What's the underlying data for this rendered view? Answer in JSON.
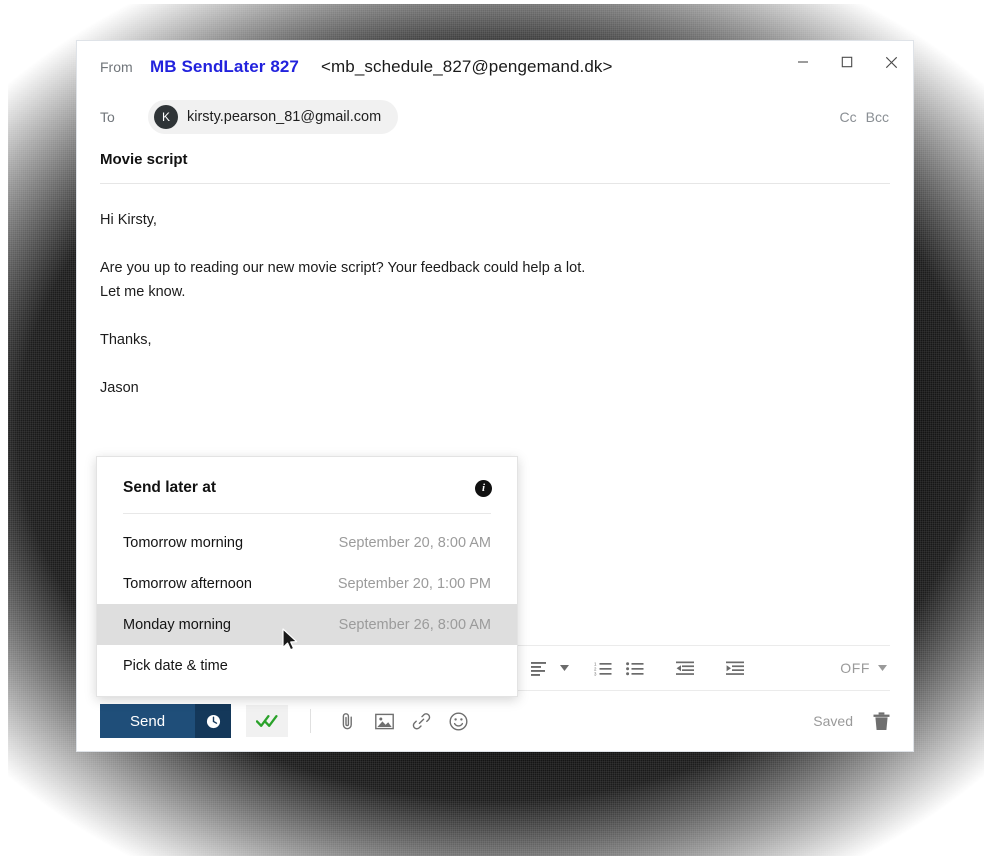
{
  "window": {
    "controls": {
      "minimize": "minimize-icon",
      "maximize": "maximize-icon",
      "close": "close-icon"
    }
  },
  "compose": {
    "from": {
      "label": "From",
      "display_name": "MB SendLater 827",
      "address": "<mb_schedule_827@pengemand.dk>",
      "name_color": "#2222dd"
    },
    "to": {
      "label": "To",
      "avatar_initial": "K",
      "recipient": "kirsty.pearson_81@gmail.com",
      "cc_label": "Cc",
      "bcc_label": "Bcc"
    },
    "subject": "Movie script",
    "body_paragraphs": [
      "Hi Kirsty,",
      "Are you up to reading our new movie script? Your feedback could help a lot.\nLet me know.",
      "Thanks,",
      "Jason"
    ]
  },
  "format_toolbar": {
    "align_icon": "align-left-icon",
    "align_caret_icon": "chevron-down-icon",
    "numbered_list_icon": "numbered-list-icon",
    "bulleted_list_icon": "bulleted-list-icon",
    "outdent_icon": "outdent-icon",
    "indent_icon": "indent-icon",
    "tracking_state": "OFF",
    "tracking_caret_icon": "chevron-down-icon"
  },
  "action_bar": {
    "send_label": "Send",
    "send_schedule_icon": "clock-icon",
    "read_receipt_icon": "double-check-icon",
    "read_receipt_color": "#2aa22a",
    "attach_icon": "paperclip-icon",
    "image_icon": "image-icon",
    "link_icon": "link-icon",
    "emoji_icon": "smiley-icon",
    "saved_label": "Saved",
    "delete_icon": "trash-icon",
    "send_button_color": "#1f4e79"
  },
  "send_later_popup": {
    "title": "Send later at",
    "info_icon": "info-icon",
    "info_glyph": "i",
    "options": [
      {
        "label": "Tomorrow morning",
        "date": "September 20, 8:00 AM",
        "selected": false
      },
      {
        "label": "Tomorrow afternoon",
        "date": "September 20, 1:00 PM",
        "selected": false
      },
      {
        "label": "Monday morning",
        "date": "September 26, 8:00 AM",
        "selected": true
      },
      {
        "label": "Pick date & time",
        "date": "",
        "selected": false
      }
    ]
  }
}
